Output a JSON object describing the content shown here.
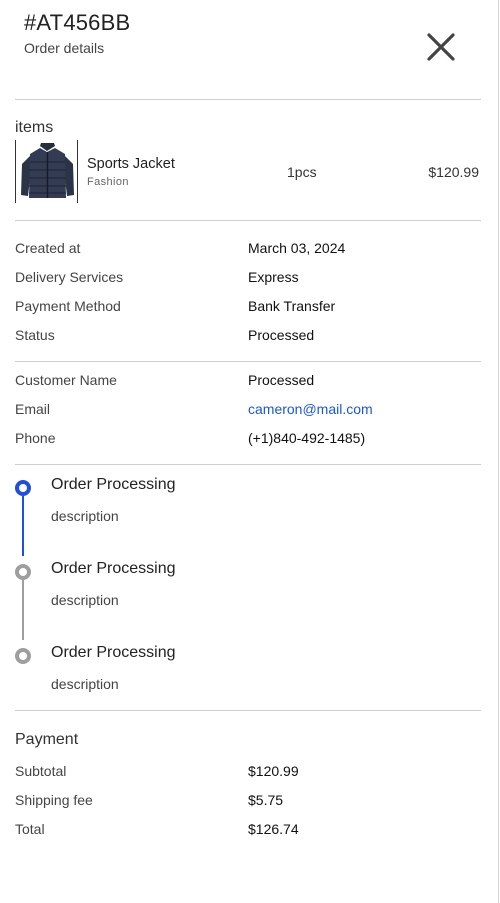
{
  "header": {
    "order_id": "#AT456BB",
    "subtitle": "Order details",
    "close_icon": "close-icon"
  },
  "items": {
    "title": "items",
    "list": [
      {
        "name": "Sports Jacket",
        "category": "Fashion",
        "quantity": "1pcs",
        "price": "$120.99",
        "thumbnail_icon": "jacket-image"
      }
    ]
  },
  "order_info": [
    {
      "label": "Created at",
      "value": "March 03, 2024"
    },
    {
      "label": "Delivery Services",
      "value": "Express"
    },
    {
      "label": "Payment Method",
      "value": "Bank Transfer"
    },
    {
      "label": "Status",
      "value": "Processed"
    }
  ],
  "customer": [
    {
      "label": "Customer Name",
      "value": "Processed"
    },
    {
      "label": "Email",
      "value": "cameron@mail.com"
    },
    {
      "label": "Phone",
      "value": "(+1)840-492-1485)"
    }
  ],
  "timeline": [
    {
      "title": "Order Processing",
      "description": "description",
      "state": "active"
    },
    {
      "title": "Order Processing",
      "description": "description",
      "state": "pending"
    },
    {
      "title": "Order Processing",
      "description": "description",
      "state": "pending"
    }
  ],
  "payment": {
    "title": "Payment",
    "rows": [
      {
        "label": "Subtotal",
        "value": "$120.99"
      },
      {
        "label": "Shipping fee",
        "value": "$5.75"
      },
      {
        "label": "Total",
        "value": "$126.74"
      }
    ]
  },
  "colors": {
    "accent": "#1f4fe0",
    "link": "#1a56db",
    "pending": "#9e9e9e",
    "divider": "#cfcfcf"
  }
}
